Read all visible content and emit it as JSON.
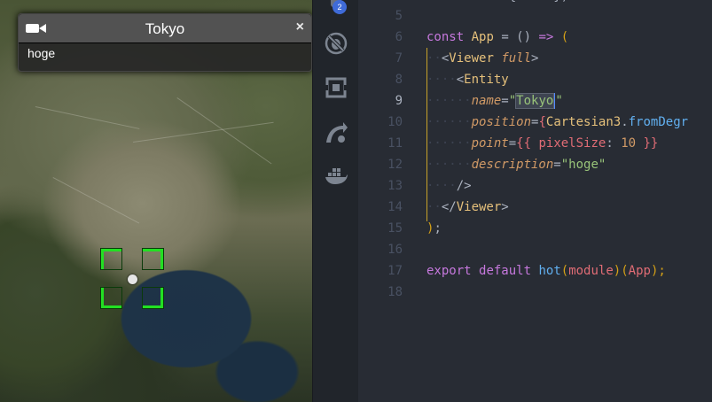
{
  "infobox": {
    "title": "Tokyo",
    "description": "hoge",
    "close_label": "×"
  },
  "activity": {
    "badge_count": "2",
    "items": [
      "bug-off-icon",
      "extensions-icon",
      "remote-explorer-icon",
      "docker-icon"
    ]
  },
  "editor": {
    "top_partial": "           { ... }) ...",
    "line_numbers": [
      "5",
      "6",
      "7",
      "8",
      "9",
      "10",
      "11",
      "12",
      "13",
      "14",
      "15",
      "16",
      "17",
      "18"
    ],
    "active_line": "9",
    "lines": {
      "l6": {
        "kw": "const",
        "name": "App",
        "rest1": " = () ",
        "arrow": "=>",
        "paren": " ("
      },
      "l7": {
        "open": "<",
        "tag": "Viewer",
        "attr": "full",
        "close": ">"
      },
      "l8": {
        "open": "<",
        "tag": "Entity"
      },
      "l9": {
        "attr": "name",
        "eq": "=",
        "q1": "\"",
        "sel": "Tokyo",
        "q2": "\""
      },
      "l10": {
        "attr": "position",
        "eq": "=",
        "brace": "{",
        "cls": "Cartesian3",
        "dot": ".",
        "fn": "fromDegr"
      },
      "l11": {
        "attr": "point",
        "eq": "=",
        "brace": "{{ ",
        "key": "pixelSize",
        "colon": ": ",
        "num": "10",
        "end": " }}"
      },
      "l12": {
        "attr": "description",
        "eq": "=",
        "str": "\"hoge\""
      },
      "l13": {
        "selfclose": "/>"
      },
      "l14": {
        "open": "</",
        "tag": "Viewer",
        "close": ">"
      },
      "l15": {
        "paren": ")",
        "semi": ";"
      },
      "l17": {
        "kw1": "export",
        "kw2": "default",
        "fn": "hot",
        "p1": "(",
        "mod": "module",
        "p2": ")(",
        "app": "App",
        "p3": ");"
      }
    }
  }
}
